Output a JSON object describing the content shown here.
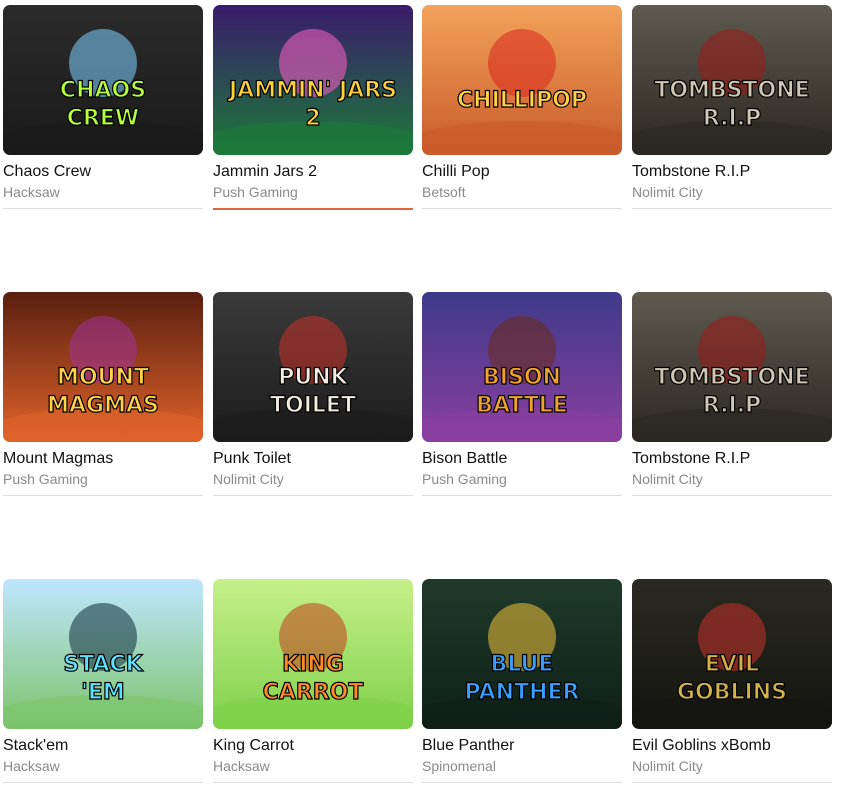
{
  "games": [
    {
      "title": "Chaos Crew",
      "provider": "Hacksaw",
      "art": "CHAOS CREW",
      "active": false,
      "colors": [
        "#2b2b2b",
        "#1a1a1a",
        "#b5ff3b",
        "#7ed0ff"
      ]
    },
    {
      "title": "Jammin Jars 2",
      "provider": "Push Gaming",
      "art": "JAMMIN' JARS 2",
      "active": true,
      "colors": [
        "#3a1b6b",
        "#1d7a3a",
        "#ffd23a",
        "#ff5fc8"
      ]
    },
    {
      "title": "Chilli Pop",
      "provider": "Betsoft",
      "art": "CHILLIPOP",
      "active": false,
      "colors": [
        "#f2a35a",
        "#c95a2a",
        "#ffd34a",
        "#d8261c"
      ]
    },
    {
      "title": "Tombstone R.I.P",
      "provider": "Nolimit City",
      "art": "TOMBSTONE R.I.P",
      "active": false,
      "colors": [
        "#5f5a4f",
        "#2b2822",
        "#cfc7b3",
        "#9e1a1a"
      ]
    },
    {
      "title": "Mount Magmas",
      "provider": "Push Gaming",
      "art": "MOUNT MAGMAS",
      "active": false,
      "colors": [
        "#5a1f10",
        "#e0632a",
        "#ffd24a",
        "#a0329a"
      ]
    },
    {
      "title": "Punk Toilet",
      "provider": "Nolimit City",
      "art": "PUNK TOILET",
      "active": false,
      "colors": [
        "#3a3a3a",
        "#1c1c1c",
        "#f2ede0",
        "#c8322a"
      ]
    },
    {
      "title": "Bison Battle",
      "provider": "Push Gaming",
      "art": "BISON BATTLE",
      "active": false,
      "colors": [
        "#3e3a8a",
        "#8a3fa0",
        "#f0a52a",
        "#6e2a14"
      ]
    },
    {
      "title": "Tombstone R.I.P",
      "provider": "Nolimit City",
      "art": "TOMBSTONE R.I.P",
      "active": false,
      "colors": [
        "#5f5a4f",
        "#2b2822",
        "#cfc7b3",
        "#9e1a1a"
      ]
    },
    {
      "title": "Stack'em",
      "provider": "Hacksaw",
      "art": "STACK 'EM",
      "active": false,
      "colors": [
        "#bfe6ff",
        "#7cc46a",
        "#5ee0ff",
        "#0c2a3a"
      ]
    },
    {
      "title": "King Carrot",
      "provider": "Hacksaw",
      "art": "KING CARROT",
      "active": false,
      "colors": [
        "#c6f08a",
        "#7fd04a",
        "#ff8a2a",
        "#c23a1a"
      ]
    },
    {
      "title": "Blue Panther",
      "provider": "Spinomenal",
      "art": "BLUE PANTHER",
      "active": false,
      "colors": [
        "#1f3a2a",
        "#0f1f18",
        "#3aa0ff",
        "#f0c23a"
      ]
    },
    {
      "title": "Evil Goblins xBomb",
      "provider": "Nolimit City",
      "art": "EVIL GOBLINS",
      "active": false,
      "colors": [
        "#2a2a22",
        "#141410",
        "#d4b24a",
        "#c8322a"
      ]
    }
  ]
}
